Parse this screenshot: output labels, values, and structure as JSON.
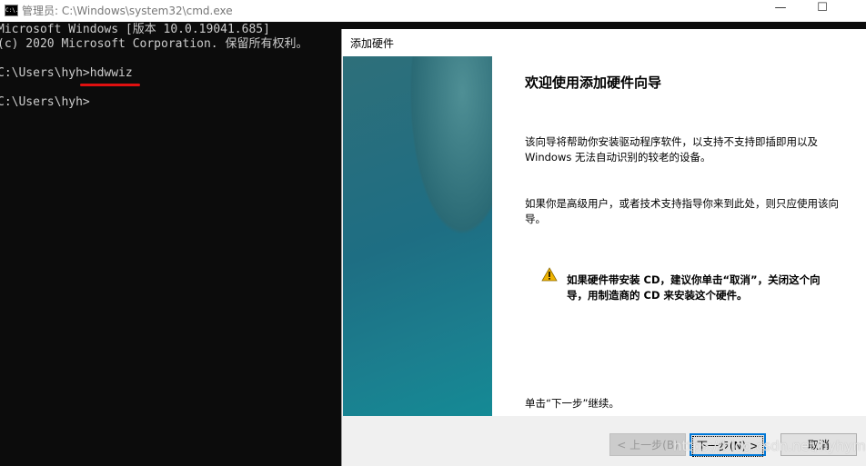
{
  "cmd": {
    "title": "管理员: C:\\Windows\\system32\\cmd.exe",
    "icon_label": "C:\\.",
    "lines": [
      "Microsoft Windows [版本 10.0.19041.685]",
      "(c) 2020 Microsoft Corporation. 保留所有权利。",
      "",
      "C:\\Users\\hyh>hdwwiz",
      "",
      "C:\\Users\\hyh>"
    ],
    "window_buttons": {
      "minimize": "—",
      "maximize": "☐"
    }
  },
  "dialog": {
    "title": "添加硬件",
    "heading": "欢迎使用添加硬件向导",
    "para1": "该向导将帮助你安装驱动程序软件，以支持不支持即插即用以及 Windows 无法自动识别的较老的设备。",
    "para2": "如果你是高级用户，或者技术支持指导你来到此处，则只应使用该向导。",
    "warning": "如果硬件带安装 CD，建议你单击“取消”，关闭这个向导，用制造商的 CD 来安装这个硬件。",
    "continue": "单击“下一步”继续。",
    "buttons": {
      "back": "< 上一步(B)",
      "next": "下一步(N) >",
      "cancel": "取消"
    }
  },
  "watermark": "https://blog.csdn.net/hyhymn",
  "colors": {
    "accent": "#0078d7",
    "underline": "#e01010",
    "warning": "#f0b400"
  }
}
